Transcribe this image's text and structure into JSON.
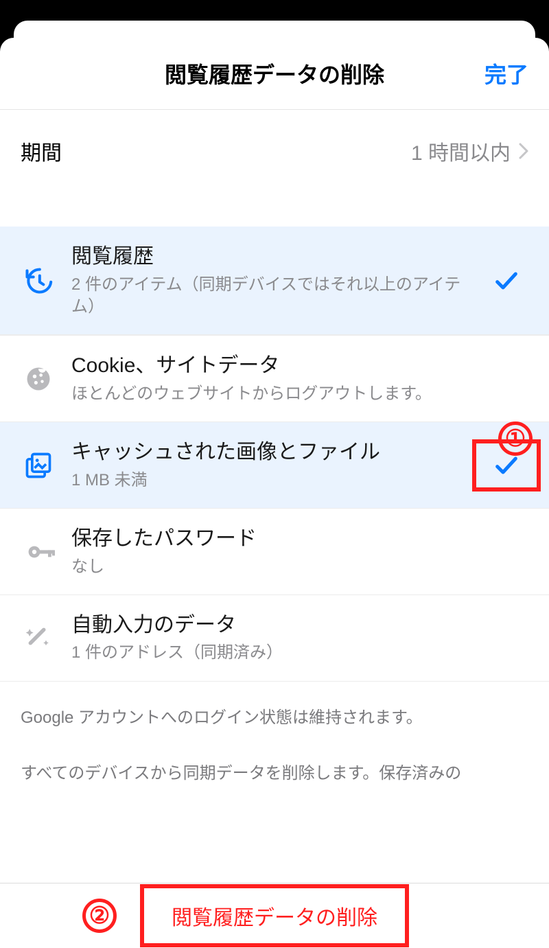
{
  "header": {
    "title": "閲覧履歴データの削除",
    "done_label": "完了"
  },
  "time_range": {
    "label": "期間",
    "value": "1 時間以内"
  },
  "items": [
    {
      "title": "閲覧履歴",
      "subtitle": "2 件のアイテム（同期デバイスではそれ以上のアイテム）",
      "selected": true
    },
    {
      "title": "Cookie、サイトデータ",
      "subtitle": "ほとんどのウェブサイトからログアウトします。",
      "selected": false
    },
    {
      "title": "キャッシュされた画像とファイル",
      "subtitle": "1 MB 未満",
      "selected": true
    },
    {
      "title": "保存したパスワード",
      "subtitle": "なし",
      "selected": false
    },
    {
      "title": "自動入力のデータ",
      "subtitle": "1 件のアドレス（同期済み）",
      "selected": false
    }
  ],
  "footer": {
    "note1": "Google アカウントへのログイン状態は維持されます。",
    "note2": "すべてのデバイスから同期データを削除します。保存済みの"
  },
  "delete_button": "閲覧履歴データの削除",
  "callouts": {
    "one": "①",
    "two": "②"
  },
  "colors": {
    "accent_blue": "#0a7aff",
    "selected_bg": "#eaf3fe",
    "annotation_red": "#ff1f1f",
    "subtext_gray": "#8a8a8d"
  }
}
